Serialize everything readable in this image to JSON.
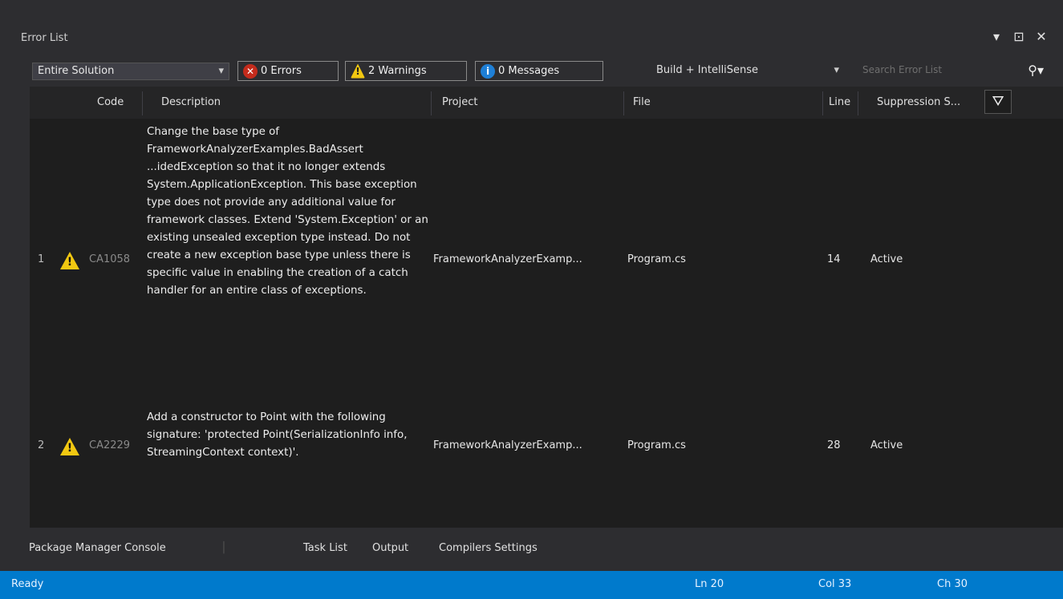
{
  "window": {
    "title": "Error List",
    "controls": [
      "▾",
      "⊡",
      "✕"
    ]
  },
  "toolbar": {
    "scope_value": "Entire Solution",
    "errors_label": "0 Errors",
    "warnings_label": "2 Warnings",
    "messages_label": "0 Messages",
    "build_filter_value": "Build + IntelliSense",
    "search_placeholder": "Search Error List"
  },
  "table": {
    "headers": {
      "code": "Code",
      "description": "Description",
      "project": "Project",
      "file": "File",
      "line": "Line",
      "suppression": "Suppression S..."
    },
    "rows": [
      {
        "index": "1",
        "code": "CA1058",
        "description": "Change the base type of FrameworkAnalyzerExamples.BadAssert ...idedException so that it no longer extends System.ApplicationException. This base exception type does not provide any additional value for framework classes. Extend 'System.Exception' or an existing unsealed exception type instead. Do not create a new exception base type unless there is specific value in enabling the creation of a catch handler for an entire class of exceptions.",
        "project": "FrameworkAnalyzerExamp...",
        "file": "Program.cs",
        "line": "14",
        "suppression": "Active"
      },
      {
        "index": "2",
        "code": "CA2229",
        "description": "Add a constructor to Point with the following signature: 'protected Point(SerializationInfo info, StreamingContext context)'.",
        "project": "FrameworkAnalyzerExamp...",
        "file": "Program.cs",
        "line": "28",
        "suppression": "Active"
      }
    ]
  },
  "bottom_tabs": {
    "package_manager": "Package Manager Console",
    "task_list": "Task List",
    "output": "Output",
    "compiler_settings": "Compilers Settings"
  },
  "status_bar": {
    "ready": "Ready",
    "ln": "Ln 20",
    "col": "Col 33",
    "ch": "Ch 30"
  },
  "colors": {
    "accent": "#007acc",
    "warning": "#f2c811",
    "error": "#c42b1c",
    "info": "#1e7fd6"
  }
}
